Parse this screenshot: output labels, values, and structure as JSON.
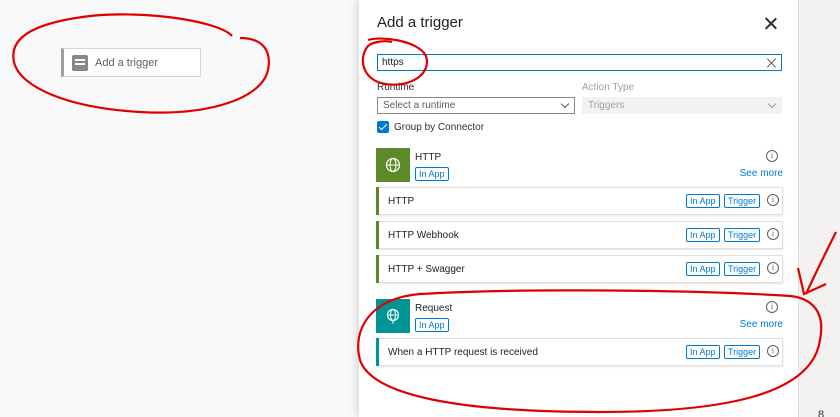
{
  "canvas": {
    "trigger_placeholder": "Add a trigger"
  },
  "panel": {
    "title": "Add a trigger",
    "search": {
      "value": "https",
      "placeholder": ""
    },
    "runtime": {
      "label": "Runtime",
      "placeholder": "Select a runtime"
    },
    "action_type": {
      "label": "Action Type",
      "value": "Triggers"
    },
    "group_by": {
      "label": "Group by Connector",
      "checked": true
    }
  },
  "connectors": [
    {
      "name": "HTTP",
      "badge": "In App",
      "see_more": "See more",
      "color": "#5c8a28",
      "icon": "globe-icon",
      "operations": [
        {
          "name": "HTTP",
          "badge1": "In App",
          "badge2": "Trigger"
        },
        {
          "name": "HTTP Webhook",
          "badge1": "In App",
          "badge2": "Trigger"
        },
        {
          "name": "HTTP + Swagger",
          "badge1": "In App",
          "badge2": "Trigger"
        }
      ]
    },
    {
      "name": "Request",
      "badge": "In App",
      "see_more": "See more",
      "color": "#009494",
      "icon": "globe-icon",
      "operations": [
        {
          "name": "When a HTTP request is received",
          "badge1": "In App",
          "badge2": "Trigger"
        }
      ]
    }
  ],
  "colors": {
    "accent": "#0078d4",
    "annotation": "#e00000"
  },
  "strip": {
    "text": "8"
  }
}
